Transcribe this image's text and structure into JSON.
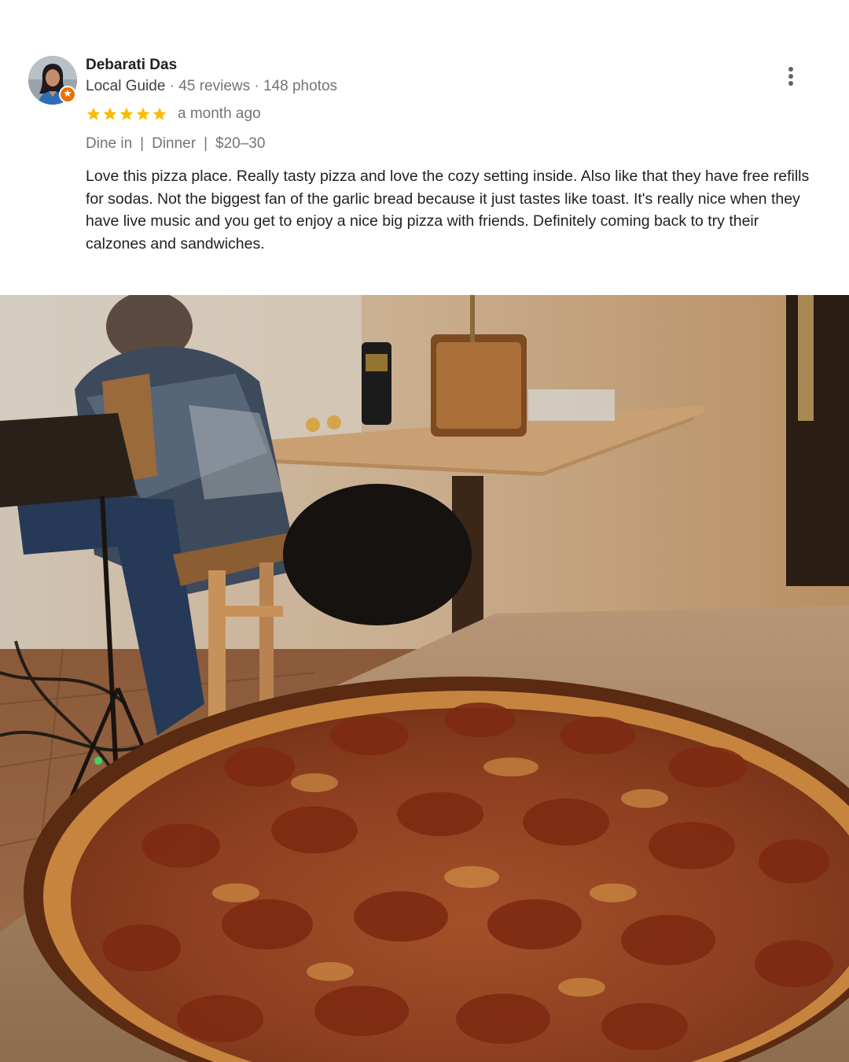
{
  "review": {
    "author": {
      "name": "Debarati Das",
      "guide_label": "Local Guide",
      "reviews_count": "45 reviews",
      "photos_count": "148 photos",
      "separator": " · ",
      "badge_glyph": "★"
    },
    "rating": {
      "stars": 5,
      "max": 5,
      "color": "#fbbc04"
    },
    "time_ago": "a month ago",
    "tags": [
      "Dine in",
      "Dinner",
      "$20–30"
    ],
    "tag_separator": "|",
    "text": "Love this pizza place. Really tasty pizza and love the cozy setting inside. Also like that they have free refills for sodas. Not the biggest fan of the garlic bread because it just tastes like toast. It's really nice when they have live music and you get to enjoy a nice big pizza with friends. Definitely coming back to try their calzones and sandwiches.",
    "menu_icon": "more-vert-icon"
  },
  "photo": {
    "subject": "pepperoni pizza on table with guitarist in background"
  },
  "colors": {
    "accent_badge": "#e8710a",
    "text_primary": "#202124",
    "text_secondary": "#70757a"
  }
}
